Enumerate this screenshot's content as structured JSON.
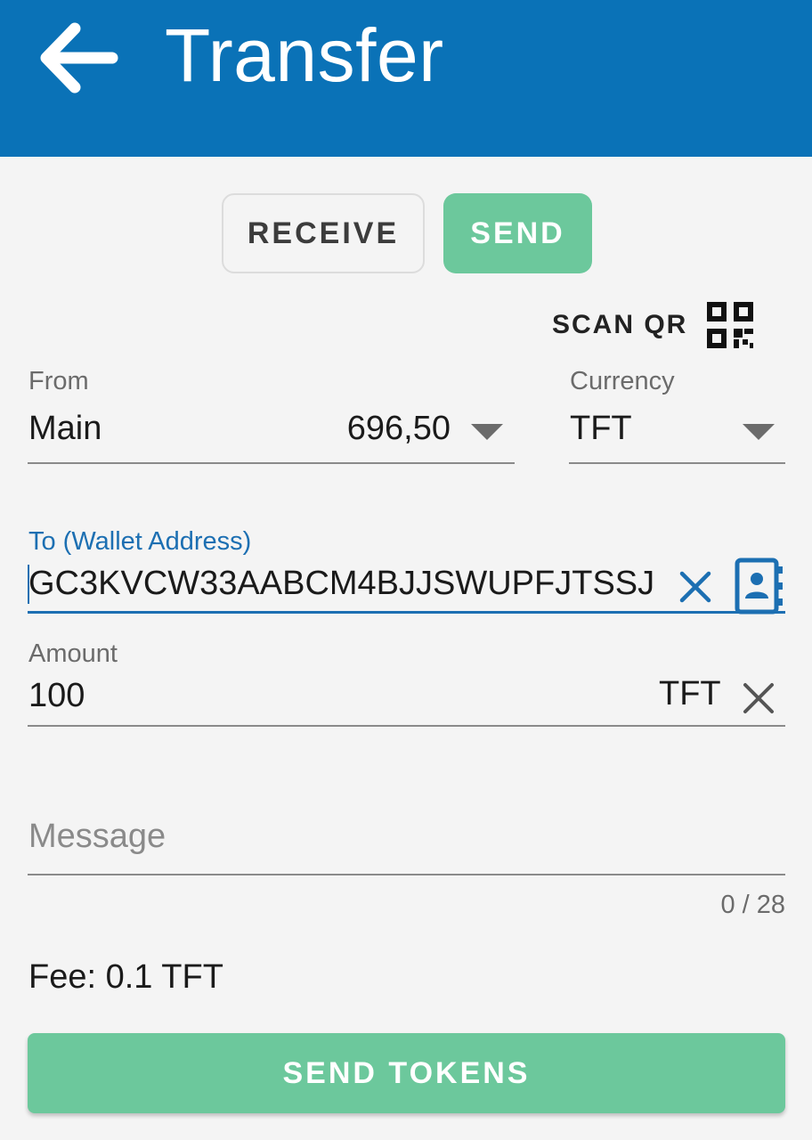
{
  "header": {
    "title": "Transfer",
    "back_icon": "arrow-left-icon"
  },
  "toggle": {
    "receive_label": "RECEIVE",
    "send_label": "SEND",
    "selected": "SEND"
  },
  "scan_qr": {
    "label": "SCAN QR",
    "icon": "qr-code-icon"
  },
  "from": {
    "label": "From",
    "wallet": "Main",
    "balance": "696,50"
  },
  "currency": {
    "label": "Currency",
    "value": "TFT"
  },
  "to": {
    "label": "To (Wallet Address)",
    "value": "GC3KVCW33AABCM4BJJSWUPFJTSSJ",
    "clear_icon": "close-icon",
    "contacts_icon": "address-book-icon"
  },
  "amount": {
    "label": "Amount",
    "value": "100",
    "unit": "TFT"
  },
  "message": {
    "placeholder": "Message",
    "counter": "0 / 28"
  },
  "fee": {
    "text": "Fee: 0.1 TFT"
  },
  "submit": {
    "label": "SEND TOKENS"
  },
  "colors": {
    "appbar": "#0a72b7",
    "accent_green": "#6cc89c",
    "focus_blue": "#1c6fb2",
    "background": "#f4f4f4"
  }
}
